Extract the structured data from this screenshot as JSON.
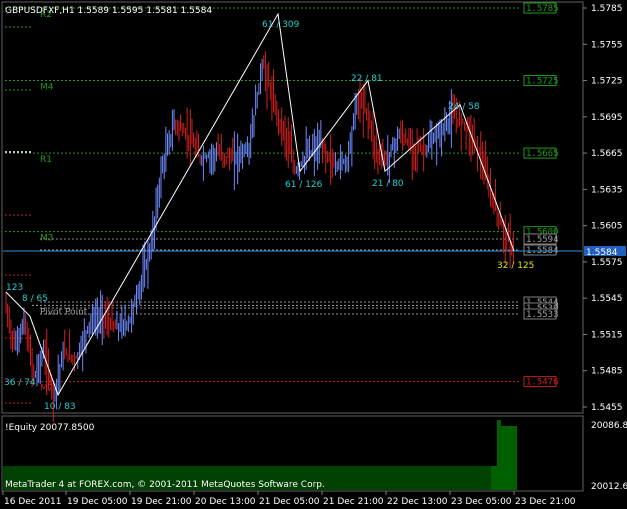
{
  "window": {
    "symbol_line": "GBPUSDFXF,H1  1.5589 1.5595 1.5581 1.5584"
  },
  "colors": {
    "background": "#000000",
    "up_bar": "#6E8BFF",
    "down_bar": "#D02020",
    "zigzag": "#FFFFFF",
    "pivot_green": "#1F9A1F",
    "pivot_red": "#C02020",
    "label_cyan": "#20D0D0",
    "label_yellow": "#E0E000",
    "axis_text": "#FFFFFF",
    "equity_bar": "#008000"
  },
  "price_axis": {
    "ticks": [
      "1.5785",
      "1.5755",
      "1.5725",
      "1.5695",
      "1.5665",
      "1.5635",
      "1.5605",
      "1.5575",
      "1.5545",
      "1.5515",
      "1.5485",
      "1.5455"
    ],
    "ylim": [
      1.5445,
      1.5796
    ]
  },
  "time_axis": {
    "labels": [
      "16 Dec 2011",
      "19 Dec 05:00",
      "19 Dec 21:00",
      "20 Dec 13:00",
      "21 Dec 05:00",
      "21 Dec 21:00",
      "22 Dec 13:00",
      "23 Dec 05:00",
      "23 Dec 21:00"
    ]
  },
  "pivot_lines": [
    {
      "name": "R2",
      "label": "R2",
      "price_tag": "1.5785",
      "value": 1.5785,
      "color": "green"
    },
    {
      "name": "M4",
      "label": "M4",
      "price_tag": "1.5725",
      "value": 1.5725,
      "color": "green"
    },
    {
      "name": "R1",
      "label": "R1",
      "price_tag": "1.5665",
      "value": 1.5665,
      "color": "green"
    },
    {
      "name": "M3",
      "label": "M3",
      "price_tag": "1.5600",
      "value": 1.56,
      "color": "green"
    },
    {
      "name": "Pivot",
      "label": "Pivot Point",
      "price_tag": "1.5539",
      "value": 1.5539,
      "color": "gray"
    },
    {
      "name": "M2",
      "label": "M2",
      "price_tag": "1.5476",
      "value": 1.5476,
      "color": "red"
    }
  ],
  "pivot_side_tags": [
    "1.5594",
    "1.5584",
    "1.5544",
    "1.5539",
    "1.5533"
  ],
  "current_price": {
    "value": 1.5584,
    "tag": "1.5584"
  },
  "zigzag_labels": [
    {
      "text": "123",
      "kind": "cyan"
    },
    {
      "text": "8 / 65",
      "kind": "cyan"
    },
    {
      "text": "36 / 74",
      "kind": "cyan"
    },
    {
      "text": "10 / 83",
      "kind": "cyan"
    },
    {
      "text": "61 / 309",
      "kind": "cyan"
    },
    {
      "text": "61 / 126",
      "kind": "cyan"
    },
    {
      "text": "22 / 81",
      "kind": "cyan"
    },
    {
      "text": "21 / 80",
      "kind": "cyan"
    },
    {
      "text": "24 / 58",
      "kind": "cyan"
    },
    {
      "text": "32 / 125",
      "kind": "yellow"
    }
  ],
  "equity": {
    "label": "!Equity 20077.8500",
    "ticks": [
      "20086.8",
      "20012.6"
    ],
    "copyright": "MetaTrader 4 at FOREX.com, © 2001-2011 MetaQuotes Software Corp."
  }
}
